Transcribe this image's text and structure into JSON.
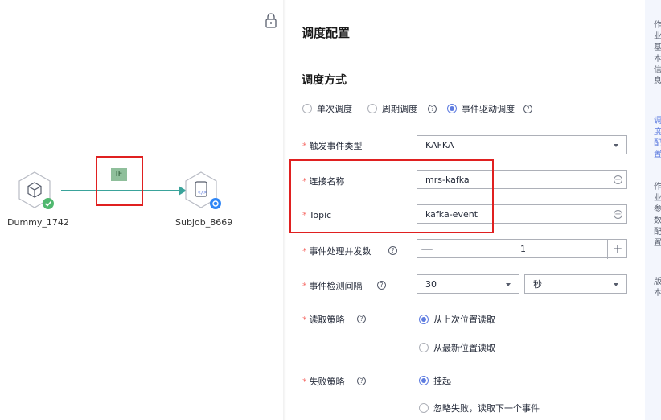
{
  "flow": {
    "node1_label": "Dummy_1742",
    "node2_label": "Subjob_8669",
    "edge_label": "IF"
  },
  "config": {
    "title": "调度配置",
    "section_title": "调度方式",
    "mode_options": [
      "单次调度",
      "周期调度",
      "事件驱动调度"
    ],
    "selected_mode": "事件驱动调度",
    "fields": {
      "event_type": {
        "label": "触发事件类型",
        "value": "KAFKA"
      },
      "connection": {
        "label": "连接名称",
        "value": "mrs-kafka"
      },
      "topic": {
        "label": "Topic",
        "value": "kafka-event"
      },
      "concurrency": {
        "label": "事件处理并发数",
        "value": "1",
        "minus": "—",
        "plus": "+"
      },
      "interval": {
        "label": "事件检测间隔",
        "value": "30",
        "unit": "秒"
      },
      "read_policy": {
        "label": "读取策略",
        "options": [
          "从上次位置读取",
          "从最新位置读取"
        ],
        "selected": "从上次位置读取"
      },
      "fail_policy": {
        "label": "失败策略",
        "options": [
          "挂起",
          "忽略失败，读取下一个事件"
        ],
        "selected": "挂起"
      }
    },
    "required_mark": "*",
    "help_glyph": "?"
  },
  "right_strip": {
    "text1": "作业基本信息",
    "text2": "调度配置",
    "text3": "作业参数配置",
    "text4": "版本"
  }
}
